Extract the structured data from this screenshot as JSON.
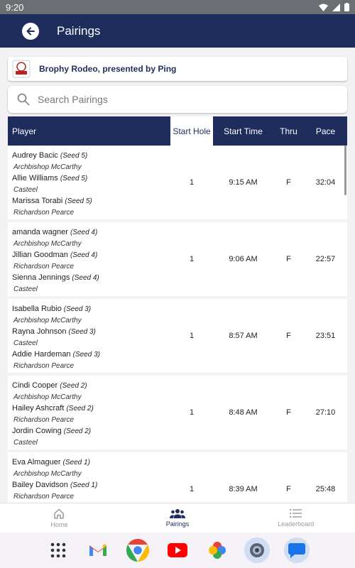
{
  "status_bar": {
    "time": "9:20"
  },
  "app_bar": {
    "title": "Pairings",
    "back_icon": "arrow-left-icon"
  },
  "event": {
    "title": "Brophy Rodeo, presented by Ping",
    "logo_icon": "rodeo-logo-icon"
  },
  "search": {
    "placeholder": "Search Pairings",
    "value": ""
  },
  "table": {
    "headers": {
      "player": "Player",
      "start_hole": "Start Hole",
      "start_time": "Start Time",
      "thru": "Thru",
      "pace": "Pace"
    },
    "rows": [
      {
        "players": [
          {
            "name": "Audrey Bacic",
            "seed": "(Seed 5)",
            "school": "Archbishop McCarthy"
          },
          {
            "name": "Allie Williams",
            "seed": "(Seed 5)",
            "school": "Casteel"
          },
          {
            "name": "Marissa Torabi",
            "seed": "(Seed 5)",
            "school": "Richardson Pearce"
          }
        ],
        "start_hole": "1",
        "start_time": "9:15 AM",
        "thru": "F",
        "pace": "32:04"
      },
      {
        "players": [
          {
            "name": "amanda wagner",
            "seed": "(Seed 4)",
            "school": "Archbishop McCarthy"
          },
          {
            "name": "Jillian Goodman",
            "seed": "(Seed 4)",
            "school": "Richardson Pearce"
          },
          {
            "name": "Sienna Jennings",
            "seed": "(Seed 4)",
            "school": "Casteel"
          }
        ],
        "start_hole": "1",
        "start_time": "9:06 AM",
        "thru": "F",
        "pace": "22:57"
      },
      {
        "players": [
          {
            "name": "Isabella Rubio",
            "seed": "(Seed 3)",
            "school": "Archbishop McCarthy"
          },
          {
            "name": "Rayna Johnson",
            "seed": "(Seed 3)",
            "school": "Casteel"
          },
          {
            "name": "Addie Hardeman",
            "seed": "(Seed 3)",
            "school": "Richardson Pearce"
          }
        ],
        "start_hole": "1",
        "start_time": "8:57 AM",
        "thru": "F",
        "pace": "23:51"
      },
      {
        "players": [
          {
            "name": "Cindi Cooper",
            "seed": "(Seed 2)",
            "school": "Archbishop McCarthy"
          },
          {
            "name": "Hailey Ashcraft",
            "seed": "(Seed 2)",
            "school": "Richardson Pearce"
          },
          {
            "name": "Jordin Cowing",
            "seed": "(Seed 2)",
            "school": "Casteel"
          }
        ],
        "start_hole": "1",
        "start_time": "8:48 AM",
        "thru": "F",
        "pace": "27:10"
      },
      {
        "players": [
          {
            "name": "Eva Almaguer",
            "seed": "(Seed 1)",
            "school": "Archbishop McCarthy"
          },
          {
            "name": "Bailey Davidson",
            "seed": "(Seed 1)",
            "school": "Richardson Pearce"
          },
          {
            "name": "",
            "seed": "",
            "school": ""
          }
        ],
        "start_hole": "1",
        "start_time": "8:39 AM",
        "thru": "F",
        "pace": "25:48"
      }
    ]
  },
  "bottom_nav": [
    {
      "label": "Home",
      "icon": "home-icon",
      "active": false
    },
    {
      "label": "Pairings",
      "icon": "people-icon",
      "active": true
    },
    {
      "label": "Leaderboard",
      "icon": "leaderboard-icon",
      "active": false
    }
  ],
  "dock": [
    "app-grid-icon",
    "gmail-icon",
    "chrome-icon",
    "youtube-icon",
    "photos-icon",
    "camera-app-icon",
    "messages-icon"
  ],
  "colors": {
    "navy": "#1f2d5c",
    "background": "#f2f2f4"
  }
}
